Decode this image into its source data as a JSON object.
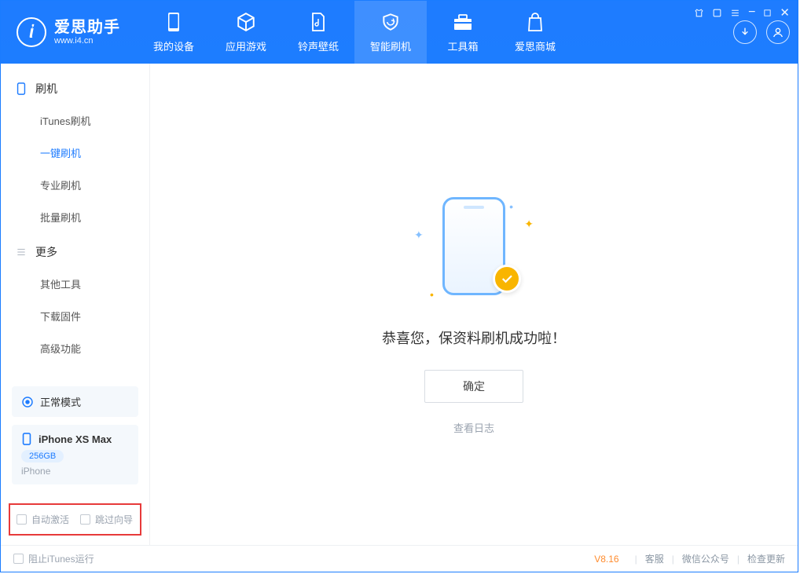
{
  "brand": {
    "title": "爱思助手",
    "subtitle": "www.i4.cn"
  },
  "nav": {
    "items": [
      {
        "label": "我的设备"
      },
      {
        "label": "应用游戏"
      },
      {
        "label": "铃声壁纸"
      },
      {
        "label": "智能刷机"
      },
      {
        "label": "工具箱"
      },
      {
        "label": "爱思商城"
      }
    ],
    "active_index": 3
  },
  "sidebar": {
    "groups": [
      {
        "title": "刷机",
        "items": [
          "iTunes刷机",
          "一键刷机",
          "专业刷机",
          "批量刷机"
        ],
        "active_index": 1
      },
      {
        "title": "更多",
        "items": [
          "其他工具",
          "下载固件",
          "高级功能"
        ],
        "active_index": -1
      }
    ],
    "mode_card": {
      "label": "正常模式"
    },
    "device_card": {
      "name": "iPhone XS Max",
      "capacity": "256GB",
      "type": "iPhone"
    },
    "checks": {
      "auto_activate": "自动激活",
      "skip_guide": "跳过向导"
    }
  },
  "main": {
    "message": "恭喜您，保资料刷机成功啦！",
    "ok_label": "确定",
    "log_link": "查看日志"
  },
  "footer": {
    "block_itunes": "阻止iTunes运行",
    "version": "V8.16",
    "links": [
      "客服",
      "微信公众号",
      "检查更新"
    ]
  }
}
